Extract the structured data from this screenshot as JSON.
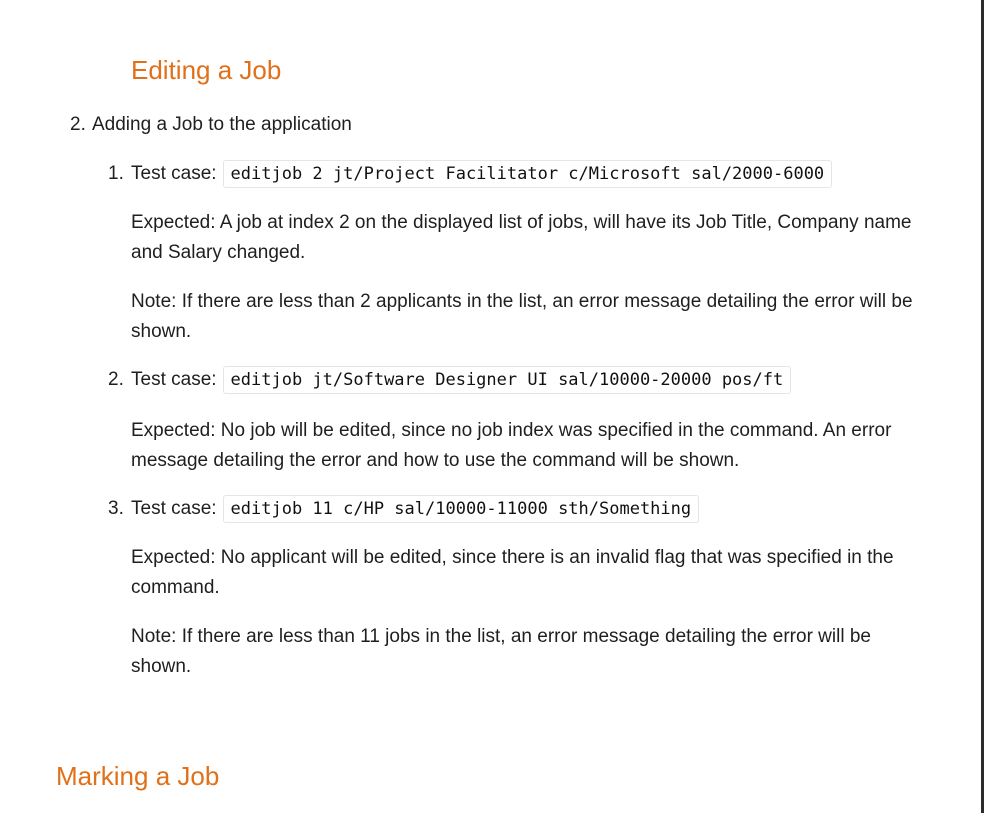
{
  "sections": {
    "editing_title": "Editing a Job",
    "marking_title": "Marking a Job"
  },
  "list": {
    "item_number": "2.",
    "item_label": "Adding a Job to the application",
    "cases": [
      {
        "number": "1.",
        "label": "Test case:",
        "command": "editjob 2 jt/Project Facilitator c/Microsoft sal/2000-6000",
        "expected": "Expected: A job at index 2 on the displayed list of jobs, will have its Job Title, Company name and Salary changed.",
        "note": "Note: If there are less than 2 applicants in the list, an error message detailing the error will be shown."
      },
      {
        "number": "2.",
        "label": "Test case:",
        "command": "editjob jt/Software Designer UI sal/10000-20000 pos/ft",
        "expected": "Expected: No job will be edited, since no job index was specified in the command. An error message detailing the error and how to use the command will be shown."
      },
      {
        "number": "3.",
        "label": "Test case:",
        "command": "editjob 11 c/HP sal/10000-11000 sth/Something",
        "expected": "Expected: No applicant will be edited, since there is an invalid flag that was specified in the command.",
        "note": "Note: If there are less than 11 jobs in the list, an error message detailing the error will be shown."
      }
    ]
  }
}
